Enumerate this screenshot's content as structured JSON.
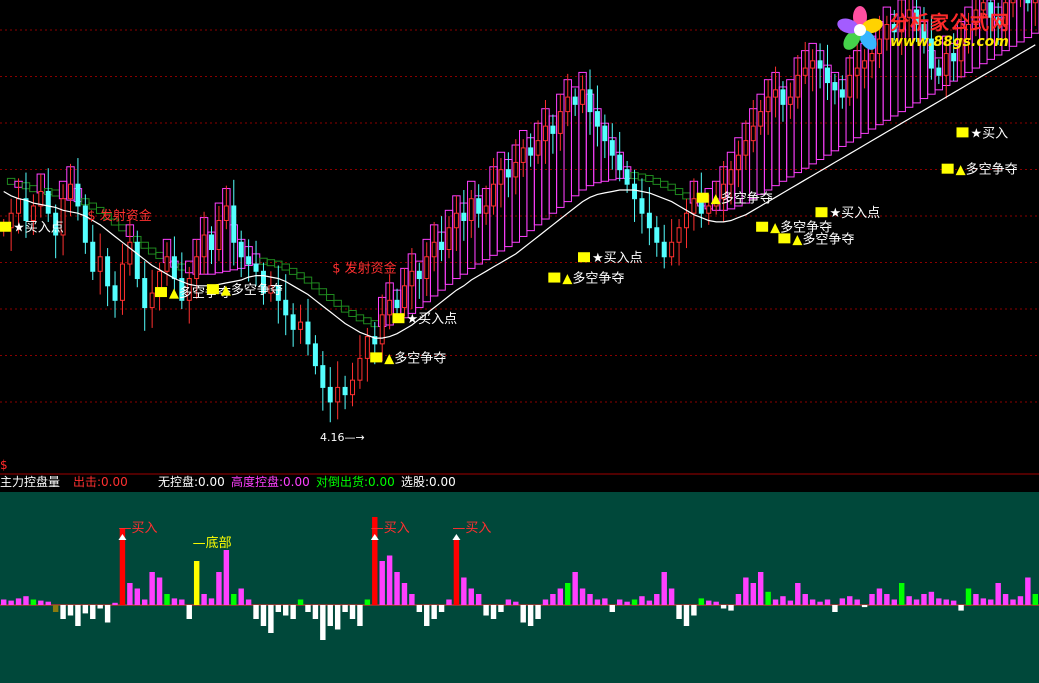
{
  "logo": {
    "title": "分析家公式网",
    "url": "www.88gs.com",
    "icon": "flower-icon"
  },
  "colors": {
    "up_candle": "#ff3030",
    "down_candle": "#54ffff",
    "ribbon_up": "#ff40ff",
    "ribbon_down": "#1f8a1f",
    "ma_line": "#ffffff",
    "marker_yellow": "#ffff00",
    "grid": "#8b0000",
    "panel_bg": "#00483a",
    "main_control": "#ff40ff",
    "no_control": "#ffffff",
    "low_control": "#00ff00",
    "buy_bar": "#ff0000",
    "bottom_bar": "#ffff00",
    "olive_bar": "#8a7a10"
  },
  "status_bar": {
    "indicator": "主力控盘量",
    "dollar": "$",
    "items": [
      {
        "label": "出击:0.00",
        "color": "#ff3030"
      },
      {
        "label": "无控盘:0.00",
        "color": "#ffffff"
      },
      {
        "label": "高度控盘:0.00",
        "color": "#ff40ff"
      },
      {
        "label": "对倒出货:0.00",
        "color": "#00ff00"
      },
      {
        "label": "选股:0.00",
        "color": "#ffffff"
      }
    ]
  },
  "chart_data": [
    {
      "type": "candlestick",
      "title": "",
      "x": "bar index 0-139",
      "ylim": [
        3.8,
        6.9
      ],
      "low_label": "4.16",
      "ma": [
        5.65,
        5.62,
        5.6,
        5.59,
        5.57,
        5.56,
        5.55,
        5.54,
        5.52,
        5.51,
        5.5,
        5.48,
        5.45,
        5.42,
        5.38,
        5.34,
        5.3,
        5.26,
        5.22,
        5.18,
        5.14,
        5.11,
        5.08,
        5.05,
        5.03,
        5.01,
        5.0,
        5.0,
        5.0,
        5.01,
        5.02,
        5.03,
        5.04,
        5.06,
        5.07,
        5.07,
        5.06,
        5.05,
        5.03,
        5.0,
        4.97,
        4.94,
        4.9,
        4.86,
        4.82,
        4.78,
        4.74,
        4.71,
        4.68,
        4.66,
        4.64,
        4.64,
        4.65,
        4.67,
        4.7,
        4.73,
        4.77,
        4.81,
        4.85,
        4.89,
        4.93,
        4.97,
        5.0,
        5.04,
        5.07,
        5.1,
        5.13,
        5.16,
        5.19,
        5.22,
        5.26,
        5.3,
        5.34,
        5.38,
        5.42,
        5.46,
        5.5,
        5.54,
        5.58,
        5.61,
        5.63,
        5.64,
        5.65,
        5.66,
        5.66,
        5.66,
        5.65,
        5.64,
        5.62,
        5.6,
        5.58,
        5.55,
        5.52,
        5.49,
        5.47,
        5.45,
        5.44,
        5.44,
        5.45,
        5.47,
        5.49,
        5.52,
        5.55,
        5.58,
        5.61,
        5.64,
        5.67,
        5.7,
        5.73,
        5.76,
        5.79,
        5.82,
        5.85,
        5.88,
        5.91,
        5.94,
        5.97,
        6.0,
        6.03,
        6.06,
        6.09,
        6.12,
        6.15,
        6.18,
        6.21,
        6.24,
        6.27,
        6.3,
        6.33,
        6.36,
        6.39,
        6.42,
        6.45,
        6.48,
        6.51,
        6.54,
        6.57,
        6.6,
        6.63,
        6.66
      ],
      "close": [
        5.4,
        5.5,
        5.6,
        5.45,
        5.55,
        5.65,
        5.5,
        5.35,
        5.6,
        5.7,
        5.55,
        5.3,
        5.1,
        5.2,
        5.0,
        4.9,
        5.15,
        5.3,
        5.05,
        4.85,
        4.95,
        5.1,
        5.2,
        5.05,
        4.9,
        5.05,
        5.2,
        5.35,
        5.25,
        5.45,
        5.55,
        5.3,
        5.2,
        5.15,
        5.1,
        4.95,
        5.0,
        4.9,
        4.8,
        4.7,
        4.75,
        4.6,
        4.45,
        4.3,
        4.2,
        4.3,
        4.25,
        4.35,
        4.5,
        4.65,
        4.6,
        4.8,
        4.9,
        4.85,
        5.0,
        5.1,
        5.05,
        5.2,
        5.3,
        5.25,
        5.4,
        5.5,
        5.45,
        5.6,
        5.5,
        5.55,
        5.7,
        5.8,
        5.75,
        5.85,
        5.95,
        5.9,
        6.0,
        6.1,
        6.05,
        6.2,
        6.3,
        6.25,
        6.35,
        6.2,
        6.1,
        6.0,
        5.9,
        5.8,
        5.7,
        5.6,
        5.5,
        5.4,
        5.3,
        5.2,
        5.3,
        5.4,
        5.5,
        5.6,
        5.5,
        5.55,
        5.6,
        5.7,
        5.8,
        5.9,
        6.0,
        6.1,
        6.2,
        6.3,
        6.35,
        6.25,
        6.3,
        6.45,
        6.5,
        6.55,
        6.5,
        6.4,
        6.35,
        6.3,
        6.45,
        6.5,
        6.55,
        6.6,
        6.7,
        6.8,
        6.75,
        6.85,
        6.9,
        6.8,
        6.7,
        6.5,
        6.45,
        6.6,
        6.55,
        6.7,
        6.8,
        6.9,
        6.95,
        6.85,
        6.8,
        6.95,
        7.0,
        7.05,
        6.95,
        7.05
      ],
      "annotations": [
        {
          "text": "买入点",
          "kind": "buy",
          "bar": 1,
          "price": 5.4
        },
        {
          "text": "$ 发射资金",
          "kind": "launch",
          "bar": 11,
          "price": 5.48
        },
        {
          "text": "多空争夺",
          "kind": "contest",
          "bar": 22,
          "price": 4.95
        },
        {
          "text": "多空争夺",
          "kind": "contest",
          "bar": 29,
          "price": 4.97
        },
        {
          "text": "$ 发射资金",
          "kind": "launch",
          "bar": 44,
          "price": 5.12
        },
        {
          "text": "买入点",
          "kind": "buy",
          "bar": 54,
          "price": 4.77
        },
        {
          "text": "多空争夺",
          "kind": "contest",
          "bar": 51,
          "price": 4.5
        },
        {
          "text": "买入点",
          "kind": "buy",
          "bar": 79,
          "price": 5.19
        },
        {
          "text": "多空争夺",
          "kind": "contest",
          "bar": 75,
          "price": 5.05
        },
        {
          "text": "多空争夺",
          "kind": "contest",
          "bar": 95,
          "price": 5.6
        },
        {
          "text": "多空争夺",
          "kind": "contest",
          "bar": 103,
          "price": 5.4
        },
        {
          "text": "多空争夺",
          "kind": "contest",
          "bar": 106,
          "price": 5.32
        },
        {
          "text": "买入点",
          "kind": "buy",
          "bar": 111,
          "price": 5.5
        },
        {
          "text": "多空争夺",
          "kind": "contest",
          "bar": 128,
          "price": 5.8
        },
        {
          "text": "买入",
          "kind": "buy",
          "bar": 130,
          "price": 6.05
        }
      ]
    },
    {
      "type": "bar",
      "title": "主力控盘量",
      "ylim": [
        -1,
        1
      ],
      "signals": [
        {
          "text": "买入",
          "kind": "buy",
          "bar": 16
        },
        {
          "text": "底部",
          "kind": "bottom",
          "bar": 26
        },
        {
          "text": "买入",
          "kind": "buy",
          "bar": 50
        },
        {
          "text": "买入",
          "kind": "buy",
          "bar": 61
        }
      ],
      "values": [
        0.05,
        0.04,
        0.06,
        0.08,
        0.05,
        0.04,
        0.03,
        -0.1,
        -0.2,
        -0.15,
        -0.3,
        -0.12,
        -0.2,
        -0.05,
        -0.25,
        0.02,
        0.7,
        0.2,
        0.15,
        0.05,
        0.3,
        0.25,
        0.1,
        0.06,
        0.05,
        -0.2,
        0.4,
        0.1,
        0.06,
        0.3,
        0.5,
        0.1,
        0.15,
        0.05,
        -0.2,
        -0.3,
        -0.4,
        -0.1,
        -0.15,
        -0.2,
        0.05,
        -0.1,
        -0.2,
        -0.5,
        -0.3,
        -0.35,
        -0.1,
        -0.2,
        -0.3,
        0.05,
        0.8,
        0.4,
        0.45,
        0.3,
        0.2,
        0.1,
        -0.1,
        -0.3,
        -0.2,
        -0.1,
        0.05,
        0.6,
        0.25,
        0.15,
        0.1,
        -0.15,
        -0.2,
        -0.1,
        0.05,
        0.03,
        -0.25,
        -0.3,
        -0.2,
        0.05,
        0.1,
        0.15,
        0.2,
        0.3,
        0.15,
        0.1,
        0.05,
        0.06,
        -0.1,
        0.05,
        0.03,
        0.05,
        0.08,
        0.04,
        0.1,
        0.3,
        0.15,
        -0.2,
        -0.3,
        -0.15,
        0.06,
        0.04,
        0.03,
        -0.05,
        -0.08,
        0.1,
        0.25,
        0.2,
        0.3,
        0.12,
        0.05,
        0.08,
        0.04,
        0.2,
        0.1,
        0.05,
        0.03,
        0.05,
        -0.1,
        0.06,
        0.08,
        0.05,
        -0.03,
        0.1,
        0.15,
        0.1,
        0.05,
        0.2,
        0.08,
        0.05,
        0.1,
        0.12,
        0.06,
        0.05,
        0.04,
        -0.08,
        0.15,
        0.1,
        0.06,
        0.05,
        0.2,
        0.1,
        0.05,
        0.08,
        0.25,
        0.1
      ]
    }
  ]
}
